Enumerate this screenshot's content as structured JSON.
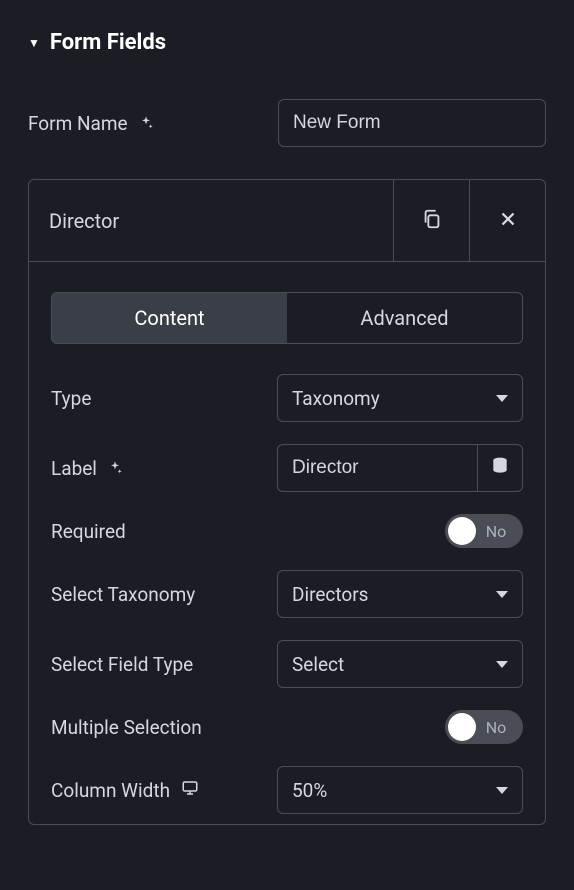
{
  "section": {
    "title": "Form Fields"
  },
  "formName": {
    "label": "Form Name",
    "value": "New Form"
  },
  "card": {
    "title": "Director",
    "tabs": {
      "content": "Content",
      "advanced": "Advanced"
    },
    "type": {
      "label": "Type",
      "value": "Taxonomy"
    },
    "label": {
      "label": "Label",
      "value": "Director"
    },
    "required": {
      "label": "Required",
      "value": "No"
    },
    "selectTaxonomy": {
      "label": "Select Taxonomy",
      "value": "Directors"
    },
    "selectFieldType": {
      "label": "Select Field Type",
      "value": "Select"
    },
    "multipleSelection": {
      "label": "Multiple Selection",
      "value": "No"
    },
    "columnWidth": {
      "label": "Column Width",
      "value": "50%"
    }
  }
}
